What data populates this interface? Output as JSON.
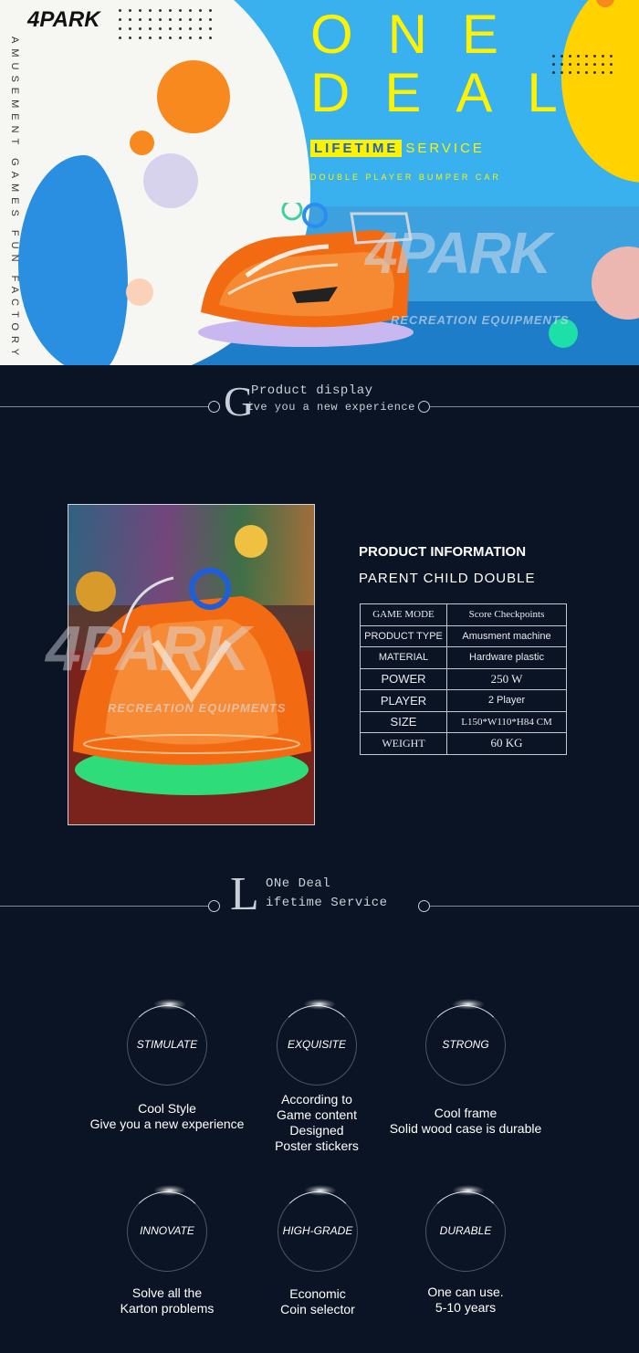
{
  "hero": {
    "logo": "4PARK",
    "side_text": "AMUSEMENT GAMES FUN FACTORY",
    "headline": "ONE DEAL",
    "lifetime_highlight": "LIFETIME",
    "lifetime_rest": "SERVICE",
    "subline": "DOUBLE PLAYER BUMPER CAR",
    "watermark": "4PARK",
    "watermark_sub": "RECREATION EQUIPMENTS"
  },
  "section1": {
    "letter": "G",
    "line1": "Product display",
    "line2": "ive you a new experience"
  },
  "product": {
    "title": "PRODUCT INFORMATION",
    "subtitle": "PARENT CHILD DOUBLE",
    "watermark": "4PARK",
    "watermark_sub": "RECREATION EQUIPMENTS",
    "specs": [
      {
        "key": "GAME MODE",
        "value": "Score Checkpoints"
      },
      {
        "key": "PRODUCT TYPE",
        "value": "Amusment machine"
      },
      {
        "key": "MATERIAL",
        "value": "Hardware plastic"
      },
      {
        "key": "POWER",
        "value": "250 W"
      },
      {
        "key": "PLAYER",
        "value": "2 Player"
      },
      {
        "key": "SIZE",
        "value": "L150*W110*H84 CM"
      },
      {
        "key": "WEIGHT",
        "value": "60 KG"
      }
    ]
  },
  "section2": {
    "letter": "L",
    "line1": "ONe Deal",
    "line2": "ifetime Service"
  },
  "features": [
    {
      "label": "STIMULATE",
      "desc": [
        "Cool Style",
        "Give you a new experience"
      ]
    },
    {
      "label": "EXQUISITE",
      "desc": [
        "According to",
        "Game content",
        "Designed",
        "Poster stickers"
      ]
    },
    {
      "label": "STRONG",
      "desc": [
        "Cool frame",
        "Solid wood case is durable"
      ]
    },
    {
      "label": "INNOVATE",
      "desc": [
        "Solve all the",
        "Karton problems"
      ]
    },
    {
      "label": "HIGH-GRADE",
      "desc": [
        "Economic",
        "Coin selector"
      ]
    },
    {
      "label": "DURABLE",
      "desc": [
        "One can use.",
        "5-10 years"
      ]
    }
  ],
  "colors": {
    "background": "#0b1424",
    "hero_blue": "#38b1ee",
    "accent_yellow": "#fff200",
    "accent_orange": "#f7891f",
    "car_orange": "#f26a12",
    "glow_green": "#2fdc7a"
  }
}
